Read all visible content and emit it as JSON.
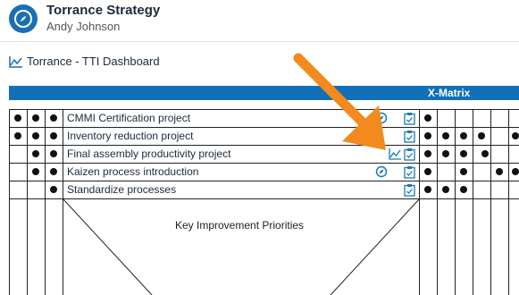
{
  "header": {
    "title": "Torrance Strategy",
    "subtitle": "Andy Johnson"
  },
  "dashboard_link": {
    "label": "Torrance - TTI Dashboard"
  },
  "matrix": {
    "title": "X-Matrix",
    "center_label": "Key Improvement Priorities",
    "rows": [
      {
        "label": "CMMI Certification project",
        "left": [
          1,
          1,
          1
        ],
        "icons": [
          "compass-icon",
          "clipboard-icon"
        ],
        "right": [
          1,
          0,
          0,
          0,
          0,
          0,
          0,
          0,
          0
        ]
      },
      {
        "label": "Inventory reduction project",
        "left": [
          1,
          1,
          1
        ],
        "icons": [
          "clipboard-icon"
        ],
        "right": [
          1,
          1,
          1,
          1,
          1,
          0,
          0,
          1
        ]
      },
      {
        "label": "Final assembly productivity project",
        "left": [
          0,
          1,
          1
        ],
        "icons": [
          "chart-icon",
          "clipboard-icon"
        ],
        "right": [
          1,
          1,
          1,
          0,
          1,
          0,
          0,
          0
        ]
      },
      {
        "label": "Kaizen process introduction",
        "left": [
          0,
          1,
          1
        ],
        "icons": [
          "compass-icon",
          "clipboard-icon"
        ],
        "right": [
          1,
          0,
          1,
          0,
          0,
          1,
          1,
          0
        ]
      },
      {
        "label": "Standardize processes",
        "left": [
          0,
          0,
          1
        ],
        "icons": [
          "clipboard-icon"
        ],
        "right": [
          1,
          1,
          1,
          0,
          0,
          0,
          0,
          0
        ]
      }
    ]
  },
  "annotation": {
    "arrow_color": "#f28a1e"
  },
  "colors": {
    "accent": "#1170b8",
    "icon_blue": "#1a7ab8"
  }
}
